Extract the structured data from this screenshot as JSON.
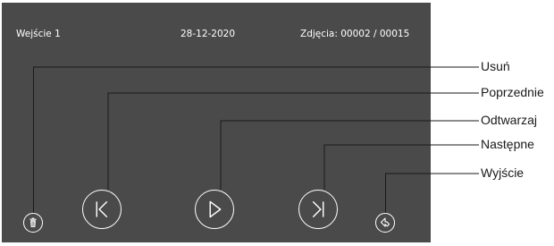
{
  "header": {
    "entrance": "Wejście 1",
    "date": "28-12-2020",
    "photos_counter": "Zdjęcia: 00002 / 00015"
  },
  "buttons": {
    "delete_icon": "trash-icon",
    "prev_icon": "skip-previous-icon",
    "play_icon": "play-icon",
    "next_icon": "skip-next-icon",
    "exit_icon": "back-arrow-icon"
  },
  "callouts": {
    "delete": "Usuń",
    "previous": "Poprzednie",
    "play": "Odtwarzaj",
    "next": "Następne",
    "exit": "Wyjście"
  },
  "colors": {
    "screen_background": "#4a4a4a",
    "foreground": "#ffffff",
    "leader_lines": "#1a1a1a"
  }
}
